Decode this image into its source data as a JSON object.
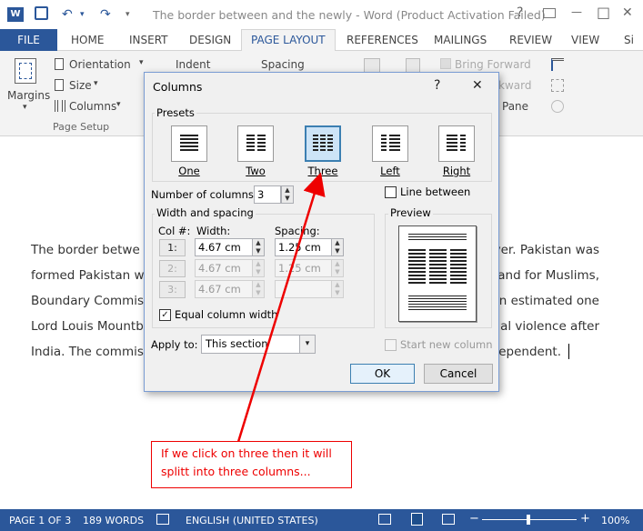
{
  "window": {
    "title": "The border between and the newly - Word (Product Activation Failed)",
    "help": "?",
    "minimize": "—",
    "restore": "□",
    "close": "✕",
    "app_icon": "W"
  },
  "quick_access": {
    "save_icon": "💾",
    "undo_icon": "↶",
    "redo_icon": "↷"
  },
  "tabs": [
    "FILE",
    "HOME",
    "INSERT",
    "DESIGN",
    "PAGE LAYOUT",
    "REFERENCES",
    "MAILINGS",
    "REVIEW",
    "VIEW",
    "Si"
  ],
  "active_tab": "PAGE LAYOUT",
  "ribbon": {
    "margins": "Margins",
    "orientation": "Orientation",
    "size": "Size",
    "columns": "Columns",
    "group_page_setup": "Page Setup",
    "indent": "Indent",
    "spacing": "Spacing",
    "bring_forward": "Bring Forward",
    "send_backward": "kward",
    "selection_pane": "Pane"
  },
  "document": {
    "lines": [
      {
        "left": "The border betwe",
        "right": "yer. Pakistan was"
      },
      {
        "left": "formed  Pakistan  w",
        "right": "and for Muslims,"
      },
      {
        "left": "Boundary Commiss",
        "right": "n  estimated  one"
      },
      {
        "left": "Lord Louis Mountb",
        "right": "al  violence  after"
      },
      {
        "left": "India.  The  commis",
        "right": "ependent."
      }
    ]
  },
  "dialog": {
    "title": "Columns",
    "help": "?",
    "close": "✕",
    "presets_label": "Presets",
    "presets": [
      {
        "label": "One",
        "key": "one"
      },
      {
        "label": "Two",
        "key": "two"
      },
      {
        "label": "Three",
        "key": "three"
      },
      {
        "label": "Left",
        "key": "left"
      },
      {
        "label": "Right",
        "key": "right"
      }
    ],
    "selected_preset": "Three",
    "number_of_columns_label": "Number of columns:",
    "number_of_columns": "3",
    "line_between_label": "Line between",
    "line_between": false,
    "width_spacing_label": "Width and spacing",
    "col_header": "Col #:",
    "width_header": "Width:",
    "spacing_header": "Spacing:",
    "rows": [
      {
        "col": "1:",
        "width": "4.67 cm",
        "spacing": "1.25 cm",
        "enabled": true
      },
      {
        "col": "2:",
        "width": "4.67 cm",
        "spacing": "1.25 cm",
        "enabled": false
      },
      {
        "col": "3:",
        "width": "4.67 cm",
        "spacing": "",
        "enabled": false
      }
    ],
    "equal_width_label": "Equal column width",
    "equal_width": true,
    "preview_label": "Preview",
    "apply_to_label": "Apply to:",
    "apply_to": "This section",
    "start_new_column_label": "Start new column",
    "ok": "OK",
    "cancel": "Cancel"
  },
  "annotation": {
    "text_line1": "If we click on three then it will",
    "text_line2": "splitt into three columns...",
    "color": "#e00000"
  },
  "status_bar": {
    "page": "PAGE 1 OF 3",
    "words": "189 WORDS",
    "language": "ENGLISH (UNITED STATES)",
    "zoom": "100%",
    "zoom_minus": "−",
    "zoom_plus": "+"
  },
  "colors": {
    "accent": "#2b579a",
    "callout": "#e00000"
  }
}
